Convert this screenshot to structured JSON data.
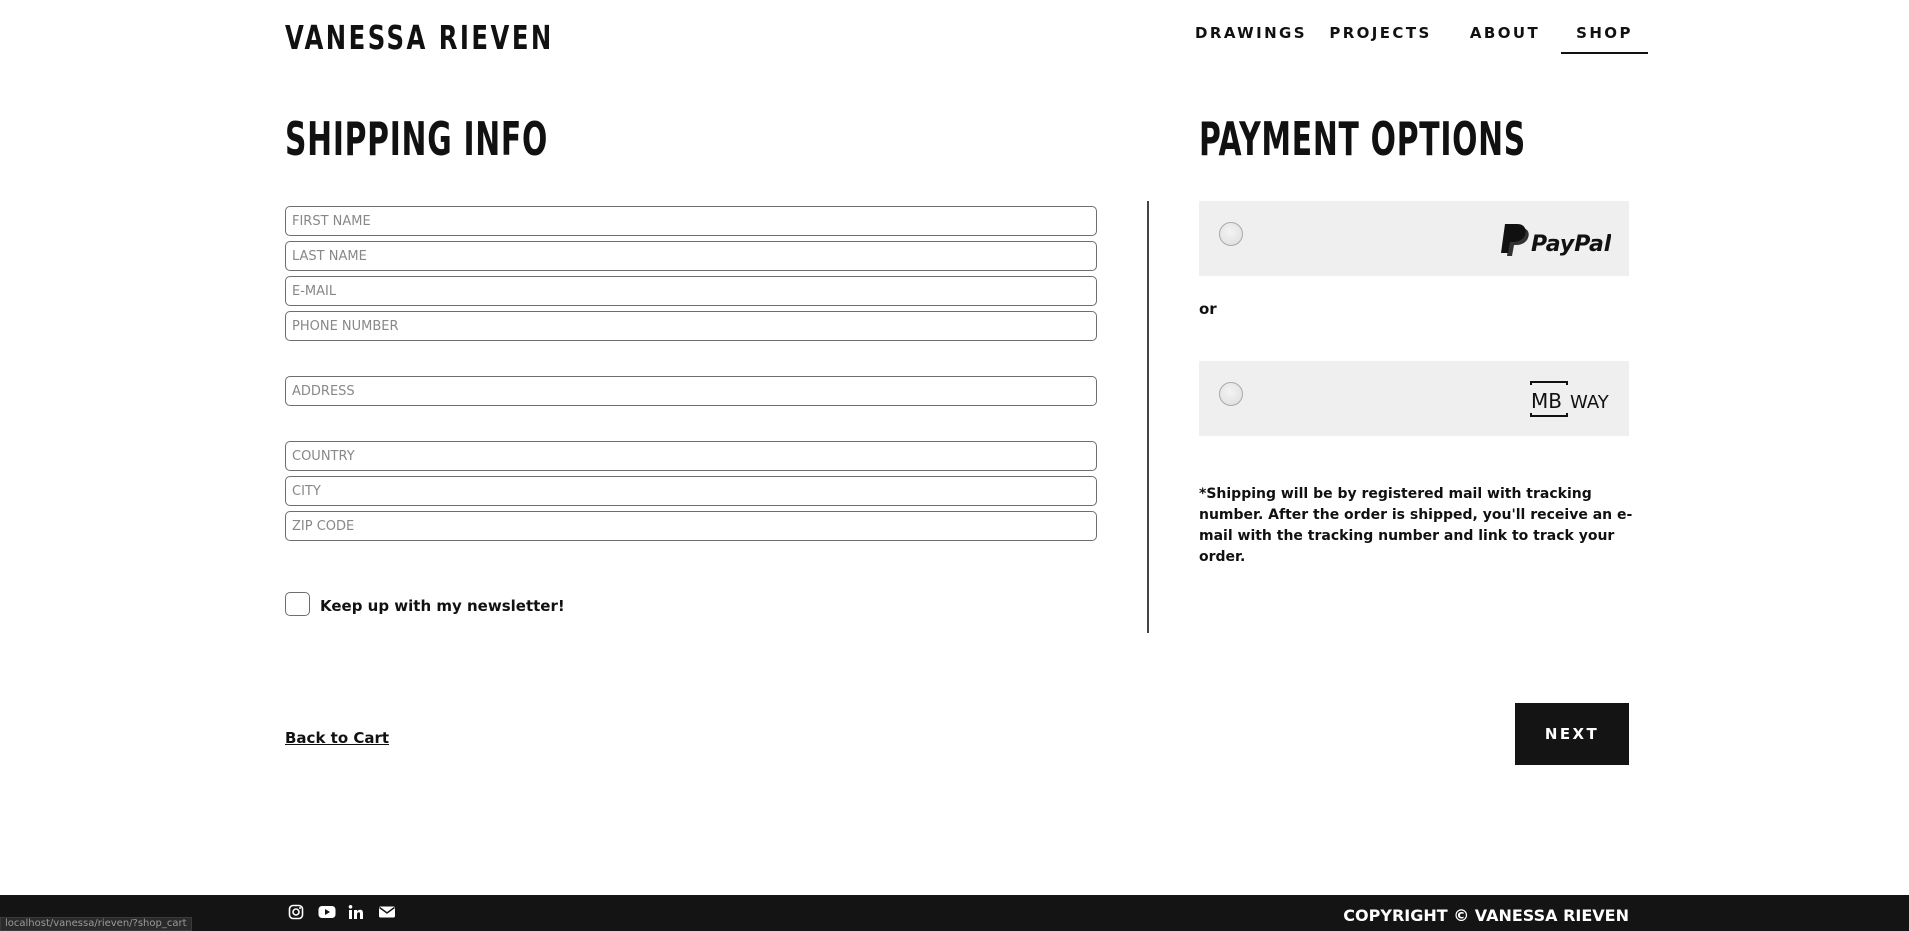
{
  "header": {
    "brand": "VANESSA RIEVEN",
    "nav": [
      {
        "label": "DRAWINGS"
      },
      {
        "label": "PROJECTS"
      },
      {
        "label": "ABOUT"
      },
      {
        "label": "SHOP",
        "active": true
      }
    ]
  },
  "shipping": {
    "title": "SHIPPING INFO",
    "fields": {
      "first_name": {
        "placeholder": "FIRST NAME",
        "value": ""
      },
      "last_name": {
        "placeholder": "LAST NAME",
        "value": ""
      },
      "email": {
        "placeholder": "E-MAIL",
        "value": ""
      },
      "phone": {
        "placeholder": "PHONE NUMBER",
        "value": ""
      },
      "address": {
        "placeholder": "ADDRESS",
        "value": ""
      },
      "country": {
        "placeholder": "COUNTRY",
        "value": ""
      },
      "city": {
        "placeholder": "CITY",
        "value": ""
      },
      "zip": {
        "placeholder": "ZIP CODE",
        "value": ""
      }
    },
    "newsletter": {
      "label": "Keep up with my newsletter!",
      "checked": false
    }
  },
  "payment": {
    "title": "PAYMENT OPTIONS",
    "options": [
      {
        "name": "PayPal",
        "icon": "paypal-logo",
        "selected": false
      },
      {
        "name": "MB WAY",
        "icon": "mbway-logo",
        "selected": false
      }
    ],
    "or_label": "or",
    "note": "*Shipping will be by registered mail with tracking number. After the order is shipped, you'll receive an e-mail with the tracking number and link to track your order."
  },
  "actions": {
    "back_label": "Back to Cart",
    "next_label": "NEXT"
  },
  "footer": {
    "social_icons": [
      "instagram-icon",
      "youtube-icon",
      "linkedin-icon",
      "mail-icon"
    ],
    "copyright": "COPYRIGHT © VANESSA RIEVEN"
  },
  "status_bar": {
    "url": "localhost/vanessa/rieven/?shop_cart"
  },
  "colors": {
    "text": "#111111",
    "button_bg": "#141414",
    "footer_bg": "#141414",
    "payment_box_bg": "#efefef",
    "field_border": "#6e6e6e",
    "placeholder": "#888888"
  }
}
